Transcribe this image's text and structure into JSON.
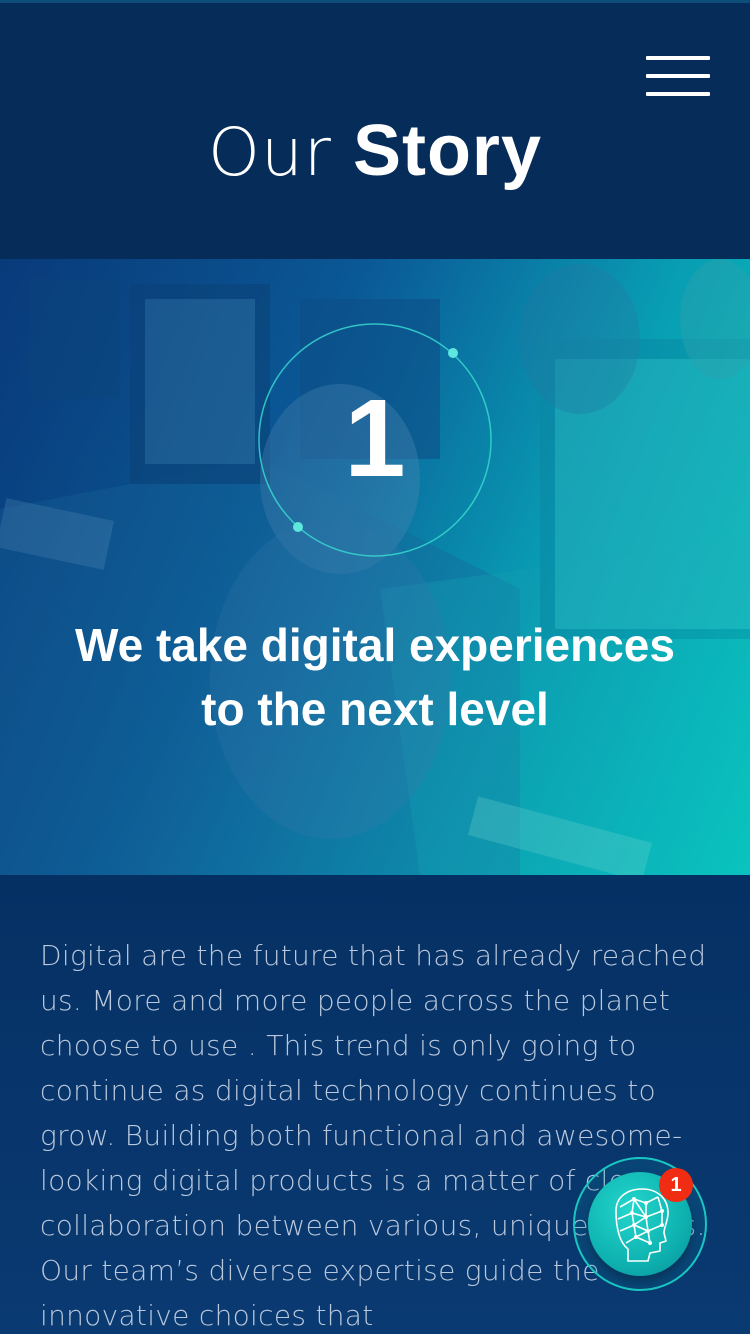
{
  "header": {
    "title_light": "Our",
    "title_bold": "Story",
    "menu_icon": "hamburger-menu-icon"
  },
  "hero": {
    "step_number": "1",
    "heading": "We take digital experiences to the next level"
  },
  "content": {
    "paragraph": "Digital are the future that has already reached us. More and more people across the planet choose to use . This trend is only going to continue as digital technology continues to grow. Building both functional and awesome-looking digital products is a matter of close collaboration between various, unique talents. Our team’s diverse expertise guide the innovative choices that"
  },
  "chat_widget": {
    "icon": "ai-head-icon",
    "badge_count": "1"
  },
  "colors": {
    "header_bg": "#062c59",
    "accent_teal": "#19c7c0",
    "badge_red": "#f02d12",
    "body_text": "#b9c8dc"
  }
}
